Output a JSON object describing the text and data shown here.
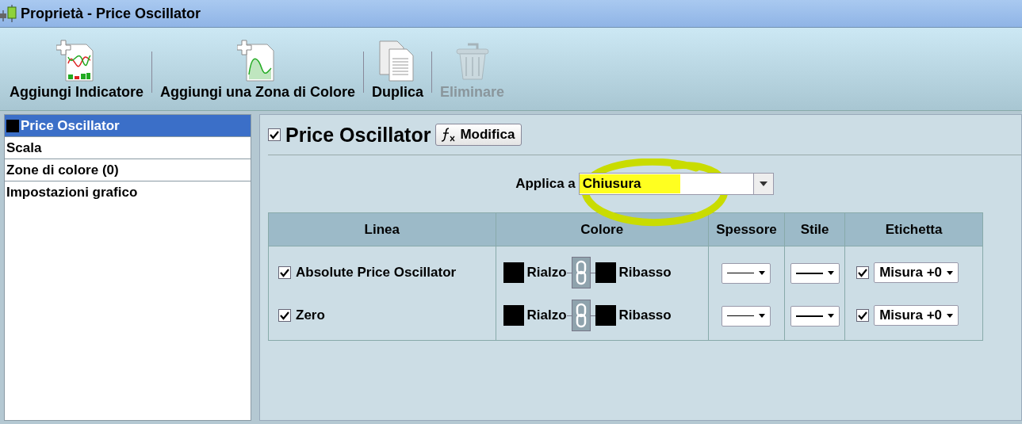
{
  "window": {
    "title": "Proprietà - Price Oscillator"
  },
  "toolbar": [
    {
      "kind": "add-indicator",
      "label": "Aggiungi Indicatore",
      "disabled": false
    },
    {
      "kind": "add-zone",
      "label": "Aggiungi una Zona di Colore",
      "disabled": false
    },
    {
      "kind": "duplicate",
      "label": "Duplica",
      "disabled": false
    },
    {
      "kind": "delete",
      "label": "Eliminare",
      "disabled": true
    }
  ],
  "sidebar": {
    "items": [
      {
        "label": "Price Oscillator",
        "selected": true,
        "color": "#000000"
      },
      {
        "label": "Scala",
        "selected": false
      },
      {
        "label": "Zone di colore (0)",
        "selected": false
      },
      {
        "label": "Impostazioni grafico",
        "selected": false
      }
    ]
  },
  "indicator": {
    "name": "Price Oscillator",
    "checked": true,
    "edit_button": "Modifica",
    "apply_label": "Applica a",
    "apply_value": "Chiusura",
    "apply_highlighted": true
  },
  "table": {
    "columns": [
      "Linea",
      "Colore",
      "Spessore",
      "Stile",
      "Etichetta"
    ],
    "rows": [
      {
        "name": "Absolute Price Oscillator",
        "checked": true,
        "colors": [
          {
            "label": "Rialzo",
            "color": "#000000"
          },
          {
            "label": "Ribasso",
            "color": "#000000"
          }
        ],
        "label_checked": true,
        "label_value": "Misura +0"
      },
      {
        "name": "Zero",
        "checked": true,
        "colors": [
          {
            "label": "Rialzo",
            "color": "#000000"
          },
          {
            "label": "Ribasso",
            "color": "#000000"
          }
        ],
        "label_checked": true,
        "label_value": "Misura +0"
      }
    ]
  }
}
